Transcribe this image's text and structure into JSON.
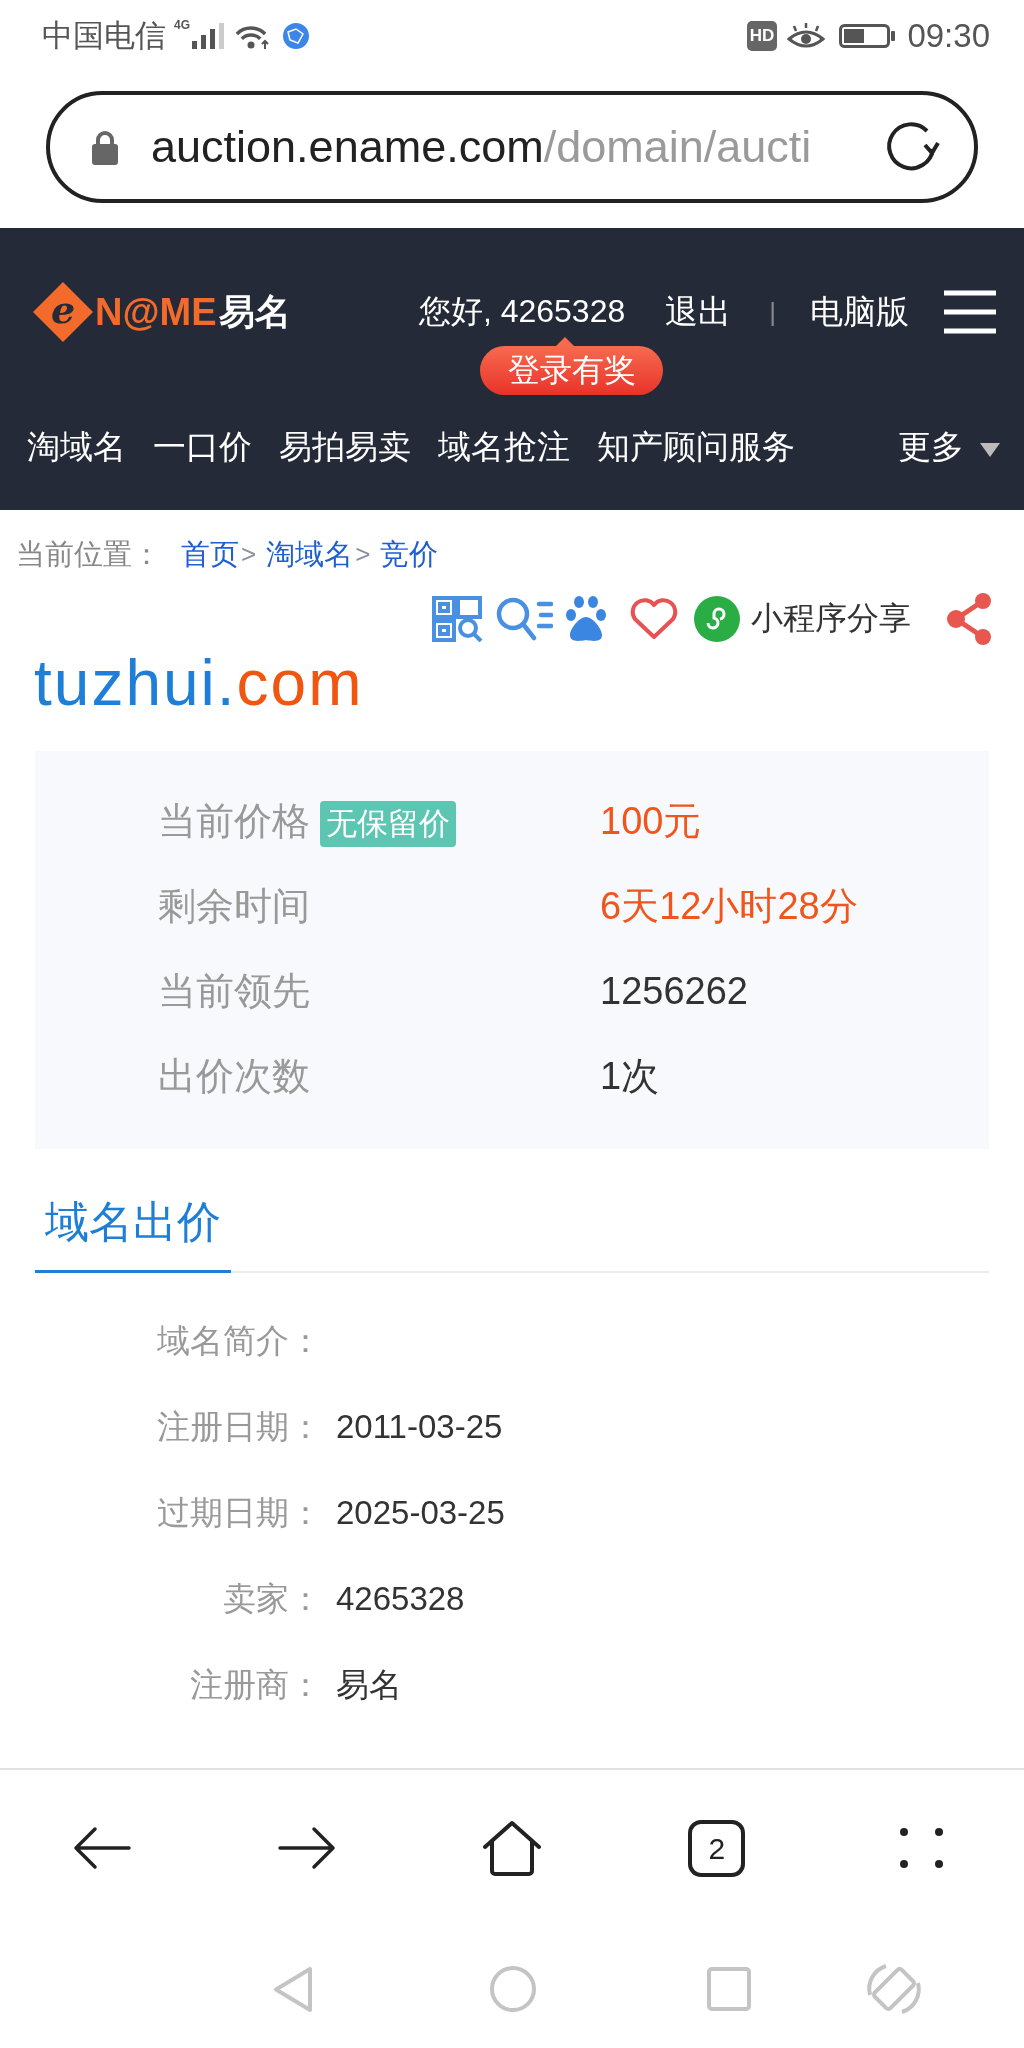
{
  "status_bar": {
    "carrier": "中国电信",
    "network": "4G",
    "hd": "HD",
    "time": "09:30"
  },
  "address_bar": {
    "host": "auction.ename.com",
    "path": "/domain/aucti"
  },
  "site_header": {
    "logo": {
      "initial": "e",
      "mark": "N@ME",
      "name": "易名"
    },
    "greeting": "您好, 4265328",
    "logout": "退出",
    "separator": "|",
    "desktop_link": "电脑版",
    "promo": "登录有奖"
  },
  "nav": {
    "items": [
      "淘域名",
      "一口价",
      "易拍易卖",
      "域名抢注",
      "知产顾问服务"
    ],
    "more": "更多"
  },
  "breadcrumb": {
    "label": "当前位置：",
    "items": [
      {
        "kind": "link",
        "text": "首页"
      },
      {
        "kind": "sep",
        "text": ">"
      },
      {
        "kind": "link",
        "text": "淘域名"
      },
      {
        "kind": "sep",
        "text": ">"
      },
      {
        "kind": "link",
        "text": "竞价"
      }
    ]
  },
  "share_bar": {
    "label": "小程序分享"
  },
  "domain": {
    "name": "tuzhui.",
    "suffix": "com"
  },
  "auction_info": [
    {
      "label": "当前价格",
      "tag": "无保留价",
      "value": "100元",
      "emphasis": true
    },
    {
      "label": "剩余时间",
      "value": "6天12小时28分",
      "emphasis": true
    },
    {
      "label": "当前领先",
      "value": "1256262",
      "emphasis": false
    },
    {
      "label": "出价次数",
      "value": "1次",
      "emphasis": false
    }
  ],
  "tabs": [
    {
      "label": "域名出价",
      "selected": true
    }
  ],
  "details": [
    {
      "label": "域名简介："
    },
    {
      "label": "注册日期：",
      "value": "2011-03-25"
    },
    {
      "label": "过期日期：",
      "value": "2025-03-25"
    },
    {
      "label": "卖家：",
      "value": "4265328"
    },
    {
      "label": "注册商：",
      "value": "易名"
    }
  ],
  "browser_toolbar": {
    "tab_count": "2"
  }
}
